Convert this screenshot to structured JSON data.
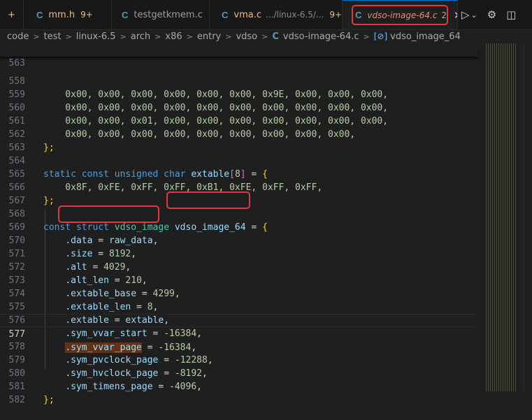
{
  "tabs": [
    {
      "icon": "C",
      "name": "mm.h",
      "badge": "9+",
      "state": "mod"
    },
    {
      "icon": "C",
      "name": "testgetkmem.c",
      "badge": "",
      "state": "normal"
    },
    {
      "icon": "C",
      "name": "vma.c",
      "path": ".../linux-6.5/...",
      "badge": "9+",
      "state": "mod"
    },
    {
      "icon": "C",
      "name": "vdso-image-64.c",
      "badge": "2",
      "state": "err"
    }
  ],
  "tab_fragment": "+",
  "toolbar": {
    "run": "▷",
    "run_menu": "⌄",
    "settings": "⚙",
    "split": "◫",
    "more": "⋯"
  },
  "breadcrumb": {
    "items": [
      "code",
      "test",
      "linux-6.5",
      "arch",
      "x86",
      "entry",
      "vdso"
    ],
    "file": "vdso-image-64.c",
    "symbol_icon": "[⊘]",
    "symbol": "vdso_image_64"
  },
  "editor": {
    "sticky_line": "563",
    "lines": [
      {
        "n": "558",
        "text": "    0x00, 0x00, 0x00, 0x00, 0x00, 0x00, 0x9E, 0x00, 0x00, 0x00,"
      },
      {
        "n": "559",
        "text": "    0x00, 0x00, 0x00, 0x00, 0x00, 0x00, 0x00, 0x00, 0x00, 0x00,"
      },
      {
        "n": "560",
        "text": "    0x00, 0x00, 0x01, 0x00, 0x00, 0x00, 0x00, 0x00, 0x00, 0x00,"
      },
      {
        "n": "561",
        "text": "    0x00, 0x00, 0x00, 0x00, 0x00, 0x00, 0x00, 0x00, 0x00,"
      },
      {
        "n": "562",
        "text": "};"
      },
      {
        "n": "563",
        "text": ""
      },
      {
        "n": "564",
        "text": "static const unsigned char extable[8] = {"
      },
      {
        "n": "565",
        "text": "    0x8F, 0xFE, 0xFF, 0xFF, 0xB1, 0xFE, 0xFF, 0xFF,"
      },
      {
        "n": "566",
        "text": "};"
      },
      {
        "n": "567",
        "text": ""
      },
      {
        "n": "568",
        "text": "const struct vdso_image vdso_image_64 = {"
      },
      {
        "n": "569",
        "text": "    .data = raw_data,"
      },
      {
        "n": "570",
        "text": "    .size = 8192,"
      },
      {
        "n": "571",
        "text": "    .alt = 4029,"
      },
      {
        "n": "572",
        "text": "    .alt_len = 210,"
      },
      {
        "n": "573",
        "text": "    .extable_base = 4299,"
      },
      {
        "n": "574",
        "text": "    .extable_len = 8,"
      },
      {
        "n": "575",
        "text": "    .extable = extable,"
      },
      {
        "n": "576",
        "text": "    .sym_vvar_start = -16384,"
      },
      {
        "n": "577",
        "text": "    .sym_vvar_page = -16384,"
      },
      {
        "n": "578",
        "text": "    .sym_pvclock_page = -12288,"
      },
      {
        "n": "579",
        "text": "    .sym_hvclock_page = -8192,"
      },
      {
        "n": "580",
        "text": "    .sym_timens_page = -4096,"
      },
      {
        "n": "581",
        "text": "};"
      },
      {
        "n": "582",
        "text": ""
      }
    ],
    "current_line": "577"
  },
  "colors": {
    "accent": "#0078d4",
    "highlight_box": "#e0393e",
    "keyword": "#569cd6",
    "number": "#b5cea8",
    "field": "#9cdcfe",
    "type": "#4ec9b0"
  }
}
